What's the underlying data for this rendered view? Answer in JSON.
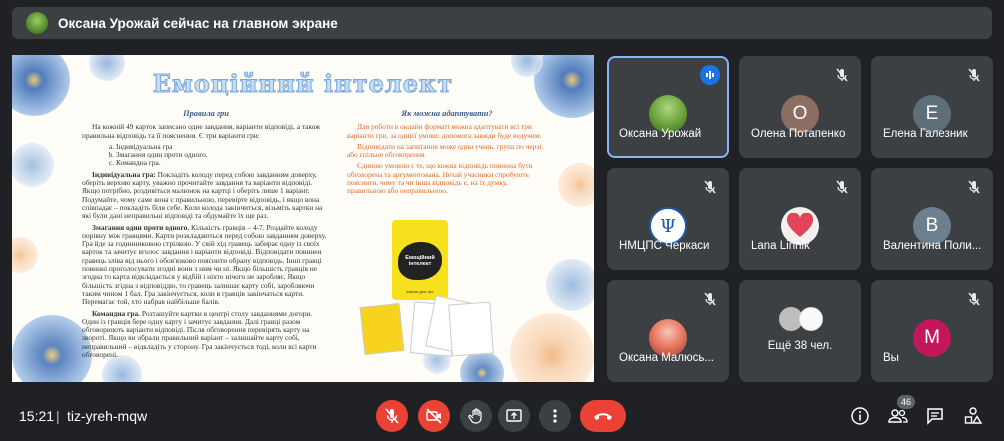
{
  "banner": {
    "text": "Оксана Урожай сейчас на главном экране"
  },
  "slide": {
    "title": "Емоційний інтелект",
    "left": {
      "heading": "Правила гри",
      "intro": "На кожній 49 карток записано одне завдання, варіанти відповіді, а також правильна відповідь та її пояснення. Є три варіанти гри:",
      "options": [
        "Індивідуальна гра",
        "Змагання один проти одного.",
        "Командна гра."
      ],
      "p1_bold": "Індивідуальна гра:",
      "p1": "Покладіть колоду перед собою завданням доверху, оберіть верхню карту, уважно прочитайте завдання та варіанти відповіді. Якщо потрібно, роздивіться малюнок на картці і оберіть лише 1 варіант. Подумайте, чому саме вона є правильною, перевірте відповідь, і якщо вона співпадає – покладіть біля себе. Коли колода закінчиться, візьміть картки на які були дані неправильні відповіді та обдумайте їх ще раз.",
      "p2_bold": "Змагання один проти одного.",
      "p2": "Кількість гравців – 4-7. Роздайте колоду порівну між гравцями. Карти розкладаються перед собою завданням доверху. Гра йде за годинниковою стрілкою. У свій хід гравець забирає одну із своїх карток та зачитує вголос завдання і варіанти відповіді. Відповідати повинен гравець зліва від нього і обов'язково пояснити обрану відповідь. Інші гравці повинні проголосувати згодні вони з ним чи ні. Якщо більшість гравців не згодна то карта відкладається у відбій і ніхто нічого не заробляє. Якщо більшість згідна з відповіддю, то гравець залишає карту собі, заробляючи таким чином 1 бал. Гра закінчується, коли в гравців закінчаться карти. Перемагає той, хто набрав найбільше балів.",
      "p3_bold": "Командна гра.",
      "p3": "Розташуйте картки в центрі столу завданнями догори. Один із гравців бере одну карту і зачитує завдання. Далі гравці разом обговорюють варіанти відповіді. Після обговорення перевірять карту на звороті. Якщо ви обрали правильний варіант – залишайте карту собі, неправильний – відкладіть у сторону. Гра закінчується тоді, коли всі карти обговорені."
    },
    "right": {
      "heading": "Як можна адаптувати?",
      "p1": "Для роботи в онлайн форматі можна адаптувати всі три варіанти гри, за однієї умови: допомога завжди буде ведучим.",
      "p2": "Відповідати на запитання може один учень, група по черзі або спільне обговорення.",
      "p3": "Єдиною умовою є те, що кожна відповідь повинна бути обговорена та аргументована. Нехай учасники спробують пояснити, чому та чи інша відповідь є, на їх думку, правильною або неправильною.",
      "box_title": "Емоційний інтелект",
      "box_sub": "картки для гри"
    }
  },
  "participants": [
    {
      "name": "Оксана Урожай",
      "avatar_type": "photo",
      "speaking": true,
      "color": "#7cb342"
    },
    {
      "name": "Олена Потапенко",
      "avatar_type": "letter",
      "letter": "О",
      "color": "#8d6e63"
    },
    {
      "name": "Елена Галезник",
      "avatar_type": "letter",
      "letter": "Е",
      "color": "#5f6f7a"
    },
    {
      "name": "НМЦПС Черкаси",
      "avatar_type": "logo",
      "color": "#1e5aa8"
    },
    {
      "name": "Lana Linnik",
      "avatar_type": "heart",
      "color": "#e0455a"
    },
    {
      "name": "Валентина Поли...",
      "avatar_type": "letter",
      "letter": "В",
      "color": "#6b7f8c"
    },
    {
      "name": "Оксана Малюсь...",
      "avatar_type": "photo2",
      "color": "#e8735a"
    },
    {
      "name": "Ещё 38 чел.",
      "avatar_type": "group"
    },
    {
      "name": "Вы",
      "avatar_type": "letter",
      "letter": "М",
      "color": "#c2185b"
    }
  ],
  "bottom": {
    "time": "15:21",
    "separator": "|",
    "meeting_code": "tiz-yreh-mqw",
    "participants_count": "46"
  },
  "colors": {
    "bg": "#202124",
    "tile": "#3c4043",
    "danger": "#ea4335",
    "accent": "#8ab4f8"
  }
}
